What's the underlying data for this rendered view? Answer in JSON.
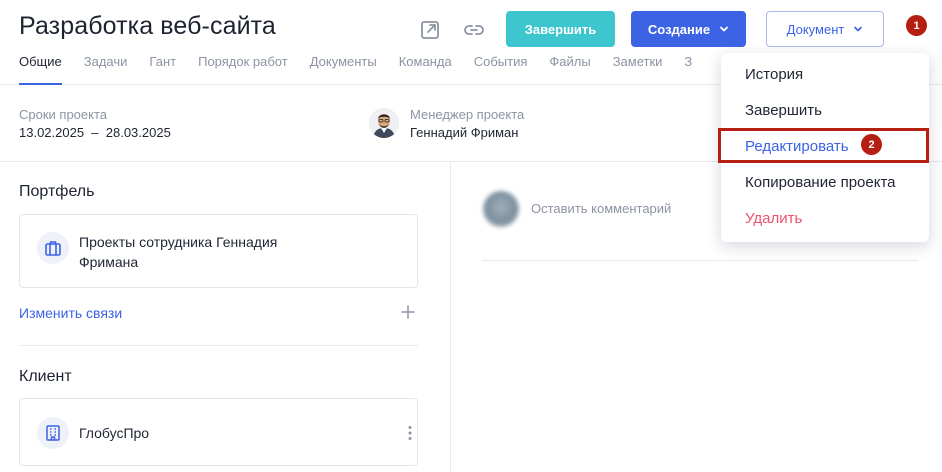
{
  "header": {
    "title": "Разработка веб-сайта",
    "finish_button": "Завершить",
    "create_button": "Создание",
    "document_button": "Документ",
    "step_badge_1": "1"
  },
  "tabs": [
    {
      "label": "Общие",
      "active": true
    },
    {
      "label": "Задачи"
    },
    {
      "label": "Гант"
    },
    {
      "label": "Порядок работ"
    },
    {
      "label": "Документы"
    },
    {
      "label": "Команда"
    },
    {
      "label": "События"
    },
    {
      "label": "Файлы"
    },
    {
      "label": "Заметки"
    },
    {
      "label": "З"
    }
  ],
  "project": {
    "dates_label": "Сроки проекта",
    "dates_value": "13.02.2025  –  28.03.2025",
    "manager_label": "Менеджер проекта",
    "manager_name": "Геннадий Фриман"
  },
  "portfolio": {
    "title": "Портфель",
    "item_line1": "Проекты сотрудника Геннадия",
    "item_line2": "Фримана",
    "change_links": "Изменить связи"
  },
  "client": {
    "title": "Клиент",
    "name": "ГлобусПро"
  },
  "comments": {
    "placeholder": "Оставить комментарий"
  },
  "dropdown": {
    "items": [
      {
        "label": "История"
      },
      {
        "label": "Завершить"
      },
      {
        "label": "Редактировать",
        "active": true
      },
      {
        "label": "Копирование проекта"
      },
      {
        "label": "Удалить",
        "danger": true
      }
    ],
    "step_badge_2": "2"
  },
  "colors": {
    "accent": "#3c63e4",
    "teal": "#3dc6ce",
    "danger": "#e9546b",
    "annotation": "#b51f12"
  }
}
